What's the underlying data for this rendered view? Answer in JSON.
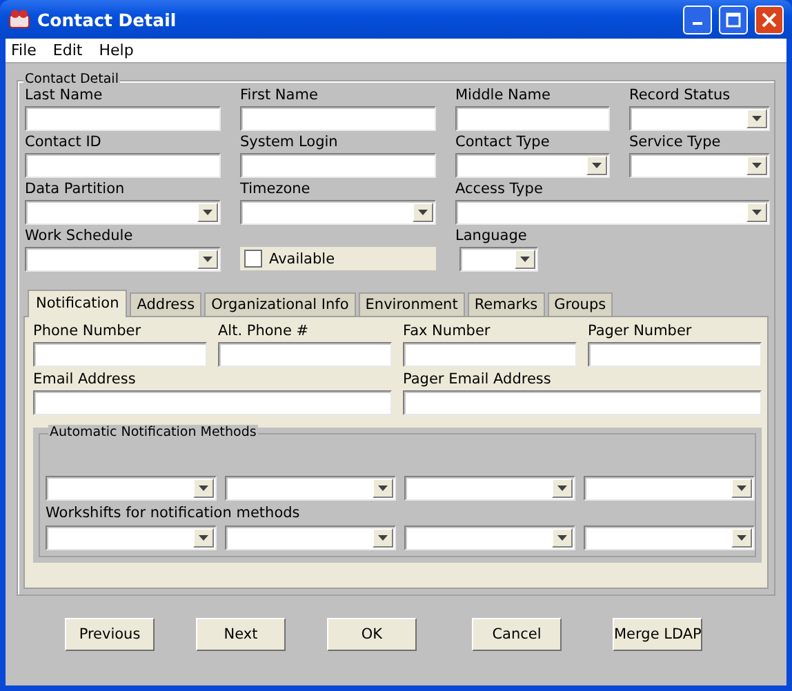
{
  "window": {
    "title": "Contact Detail"
  },
  "menu": [
    "File",
    "Edit",
    "Help"
  ],
  "contact_detail": {
    "title": "Contact Detail",
    "rows": [
      [
        {
          "label": "Last Name",
          "kind": "text"
        },
        {
          "label": "First Name",
          "kind": "text"
        },
        {
          "label": "Middle Name",
          "kind": "text"
        },
        {
          "label": "Record Status",
          "kind": "combo"
        }
      ],
      [
        {
          "label": "Contact ID",
          "kind": "text"
        },
        {
          "label": "System Login",
          "kind": "text"
        },
        {
          "label": "Contact Type",
          "kind": "combo"
        },
        {
          "label": "Service Type",
          "kind": "combo"
        }
      ],
      [
        {
          "label": "Data Partition",
          "kind": "combo"
        },
        {
          "label": "Timezone",
          "kind": "combo"
        },
        {
          "label": "Access Type",
          "kind": "wide_combo"
        }
      ],
      [
        {
          "label": "Work Schedule",
          "kind": "combo"
        },
        {
          "label": "Available",
          "kind": "checkbox",
          "checked": false
        },
        {
          "label": "Language",
          "kind": "small_combo"
        }
      ]
    ]
  },
  "tabs": [
    {
      "label": "Notification",
      "selected": true
    },
    {
      "label": "Address",
      "selected": false
    },
    {
      "label": "Organizational Info",
      "selected": false
    },
    {
      "label": "Environment",
      "selected": false
    },
    {
      "label": "Remarks",
      "selected": false
    },
    {
      "label": "Groups",
      "selected": false
    }
  ],
  "notification": {
    "number_fields": [
      {
        "label": "Phone Number",
        "kind": "text"
      },
      {
        "label": "Alt. Phone #",
        "kind": "text"
      },
      {
        "label": "Fax Number",
        "kind": "text"
      },
      {
        "label": "Pager Number",
        "kind": "text"
      }
    ],
    "email_fields": [
      {
        "label": "Email Address",
        "kind": "wide_text"
      },
      {
        "label": "Pager Email Address",
        "kind": "wide_text"
      }
    ],
    "methods_group": {
      "title": "Automatic Notification Methods",
      "workshift_label": "Workshifts for notification methods"
    }
  },
  "buttons": [
    "Previous",
    "Next",
    "OK",
    "Cancel",
    "Merge LDAP"
  ]
}
